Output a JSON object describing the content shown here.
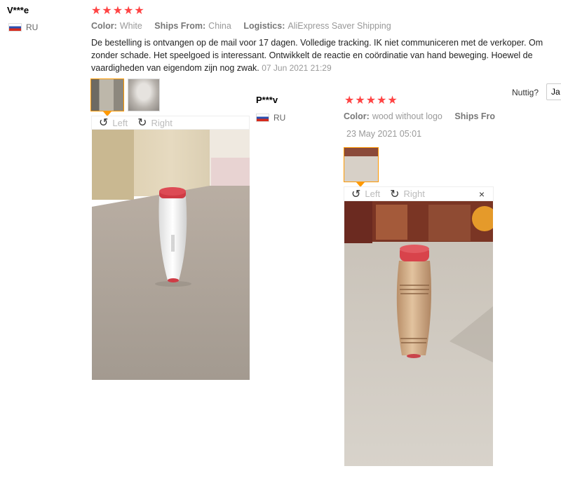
{
  "review1": {
    "name": "V***e",
    "country": "RU",
    "stars": "★★★★★",
    "color_label": "Color:",
    "color_value": "White",
    "ships_label": "Ships From:",
    "ships_value": "China",
    "logistics_label": "Logistics:",
    "logistics_value": "AliExpress Saver Shipping",
    "text": "De bestelling is ontvangen op de mail voor 17 dagen. Volledige tracking. IK niet communiceren met de verkoper. Om zonder schade. Het speelgoed is interessant. Ontwikkelt de reactie en coördinatie van hand beweging. Hoewel de vaardigheden van eigendom zijn nog zwak.",
    "date": "07 Jun 2021 21:29",
    "rotate_left": "Left",
    "rotate_right": "Right"
  },
  "review2": {
    "name": "P***v",
    "country": "RU",
    "stars": "★★★★★",
    "color_label": "Color:",
    "color_value": "wood without logo",
    "ships_label": "Ships Fro",
    "date": "23 May 2021 05:01",
    "rotate_left": "Left",
    "rotate_right": "Right",
    "close": "×"
  },
  "helpful": {
    "label": "Nuttig?",
    "button": "Ja"
  },
  "icons": [
    "flag-ru-icon",
    "rotate-left-icon",
    "rotate-right-icon",
    "close-icon"
  ],
  "colors": {
    "star": "#ff4444",
    "active_border": "#ff9900"
  }
}
